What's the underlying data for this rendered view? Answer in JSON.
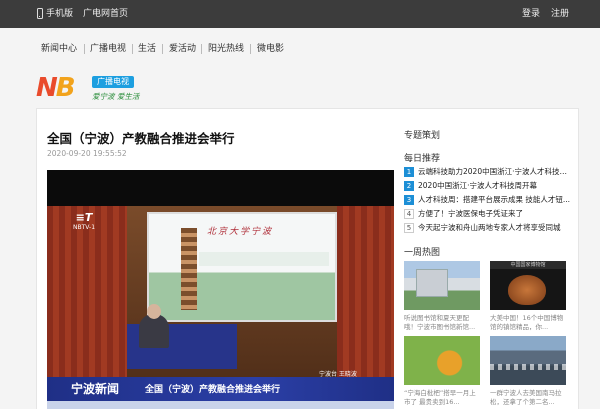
{
  "topbar": {
    "mobile_label": "手机版",
    "home_label": "广电网首页",
    "login_label": "登录",
    "register_label": "注册"
  },
  "nav": {
    "items": [
      "新闻中心",
      "广播电视",
      "生活",
      "爱活动",
      "阳光热线",
      "微电影"
    ]
  },
  "logo": {
    "badge": "广播电视",
    "slogan": "爱宁波 爱生活"
  },
  "article": {
    "title": "全国（宁波）产教融合推进会举行",
    "date": "2020-09-20 19:55:52"
  },
  "video": {
    "channel_text": "NBTV-1",
    "screen_text": "北京大学宁波",
    "show_name": "宁波新闻",
    "caption": "全国（宁波）产教融合推进会举行",
    "reporter": "宁波台 王晓波"
  },
  "sidebar": {
    "topics_heading": "专题策划",
    "daily_heading": "每日推荐",
    "daily": [
      {
        "num": "1",
        "text": "云端科技助力2020中国浙江·宁波人才科技周..."
      },
      {
        "num": "2",
        "text": "2020中国浙江·宁波人才科技周开幕"
      },
      {
        "num": "3",
        "text": "人才科技周：搭建平台展示成果 技能人才钮..."
      },
      {
        "num": "4",
        "text": "方便了！宁波医保电子凭证来了"
      },
      {
        "num": "5",
        "text": "今天起宁波和舟山两地专家人才将享受同城"
      }
    ],
    "weekly_heading": "一周热图",
    "photos": [
      {
        "name": "photo-library",
        "caption": "听说图书馆和夏天更配哦！宁波市图书馆新馆..."
      },
      {
        "name": "photo-pottery",
        "banner": "中国国家博物馆",
        "caption": "大美中国！16个中国博物馆的镇馆精品，你..."
      },
      {
        "name": "photo-peach",
        "caption": "“宁海白枇杷”搭早一月上市了 最贵卖到16..."
      },
      {
        "name": "photo-street",
        "caption": "一群宁波人去美国南马拉松，还拿了个第二名..."
      }
    ]
  }
}
